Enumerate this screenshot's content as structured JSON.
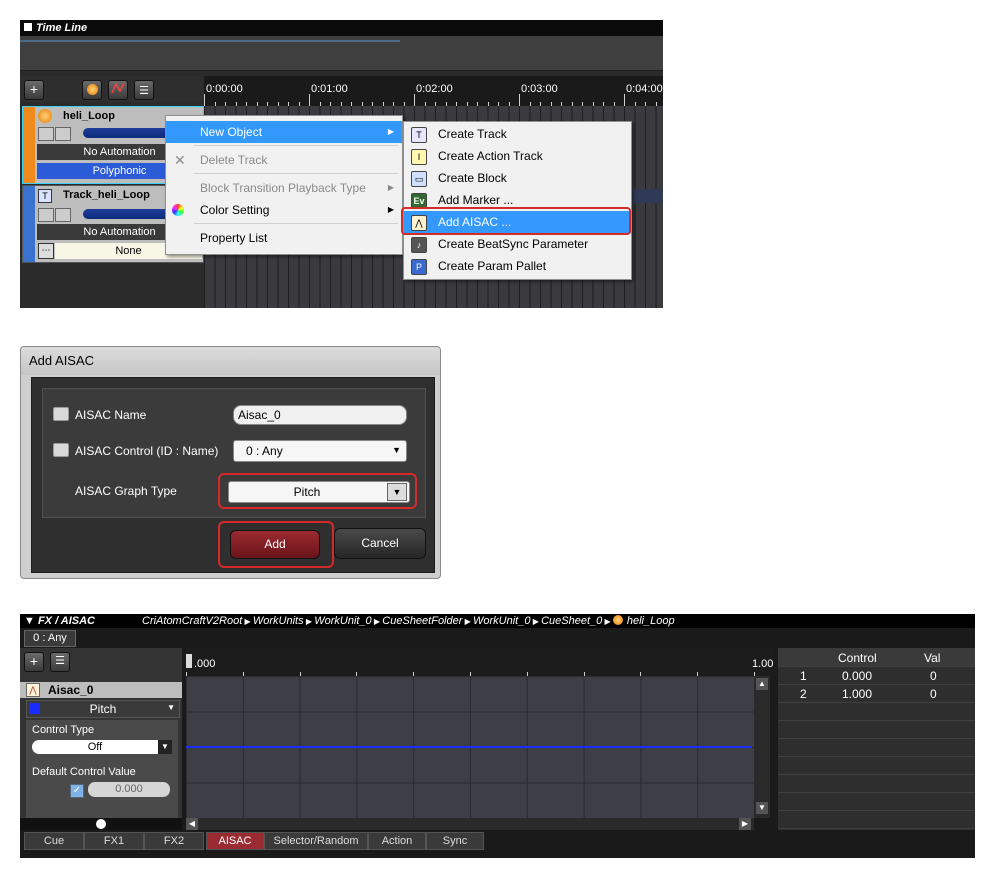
{
  "timeline": {
    "title": "Time Line",
    "ruler_ticks": [
      "0:00:00",
      "0:01:00",
      "0:02:00",
      "0:03:00",
      "0:04:00"
    ],
    "tracks": [
      {
        "name": "heli_Loop",
        "automation": "No Automation",
        "mode": "Polyphonic",
        "color": "#f08a1c"
      },
      {
        "name": "Track_heli_Loop",
        "automation": "No Automation",
        "mode": "None",
        "color": "#3a72d0"
      }
    ],
    "context_menu": {
      "items": [
        {
          "label": "New Object",
          "state": "selected"
        },
        {
          "label": "Delete Track",
          "state": "disabled"
        },
        {
          "label": "Block Transition Playback Type",
          "state": "disabled"
        },
        {
          "label": "Color Setting",
          "state": "normal"
        },
        {
          "label": "Property List",
          "state": "normal"
        }
      ]
    },
    "submenu": {
      "items": [
        "Create Track",
        "Create Action Track",
        "Create Block",
        "Add Marker ...",
        "Add AISAC ...",
        "Create BeatSync Parameter",
        "Create Param Pallet"
      ],
      "highlighted": "Add AISAC ..."
    }
  },
  "dialog": {
    "title": "Add AISAC",
    "name_label": "AISAC Name",
    "name_value": "Aisac_0",
    "control_label": "AISAC Control (ID : Name)",
    "control_value": "0 : Any",
    "graph_type_label": "AISAC Graph Type",
    "graph_type_value": "Pitch",
    "add_label": "Add",
    "cancel_label": "Cancel"
  },
  "fx_panel": {
    "title": "FX / AISAC",
    "breadcrumb": [
      "CriAtomCraftV2Root",
      "WorkUnits",
      "WorkUnit_0",
      "CueSheetFolder",
      "WorkUnit_0",
      "CueSheet_0",
      "heli_Loop"
    ],
    "control_tab": "0 : Any",
    "aisac_name": "Aisac_0",
    "graph_type": "Pitch",
    "control_type_label": "Control Type",
    "control_type_value": "Off",
    "default_control_label": "Default Control Value",
    "default_control_value": "0.000",
    "axis_start": ".000",
    "axis_end": "1.00",
    "table": {
      "headers": [
        "Control",
        "Val"
      ],
      "rows": [
        {
          "index": "1",
          "control": "0.000",
          "value": "0"
        },
        {
          "index": "2",
          "control": "1.000",
          "value": "0"
        }
      ]
    },
    "bottom_tabs": [
      "Cue",
      "FX1",
      "FX2",
      "AISAC",
      "Selector/Random",
      "Action",
      "Sync"
    ],
    "active_tab": "AISAC"
  },
  "colors": {
    "accent_red": "#d62a2a",
    "menu_highlight": "#3399ff",
    "curve_blue": "#1a2cff"
  }
}
